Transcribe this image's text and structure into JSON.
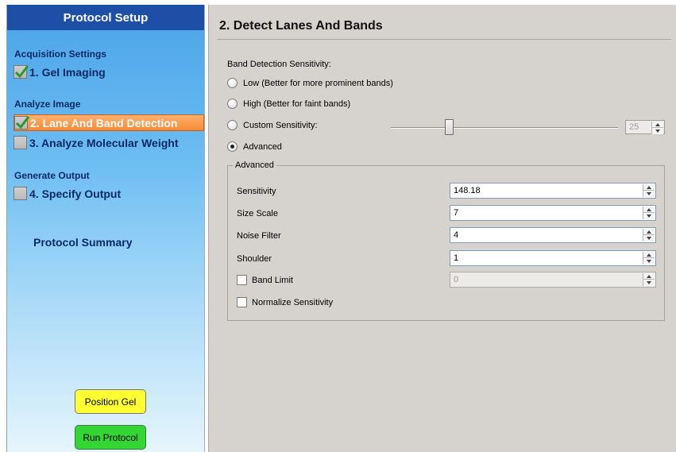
{
  "sidebar": {
    "header": "Protocol Setup",
    "sections": [
      {
        "title": "Acquisition Settings"
      },
      {
        "title": "Analyze Image"
      },
      {
        "title": "Generate Output"
      }
    ],
    "steps": [
      {
        "label": "1. Gel Imaging",
        "checked": true,
        "selected": false
      },
      {
        "label": "2. Lane And Band Detection",
        "checked": true,
        "selected": true
      },
      {
        "label": "3. Analyze Molecular Weight",
        "checked": false,
        "selected": false
      },
      {
        "label": "4. Specify Output",
        "checked": false,
        "selected": false
      }
    ],
    "summary_label": "Protocol Summary",
    "position_gel_label": "Position Gel",
    "run_protocol_label": "Run Protocol"
  },
  "main": {
    "title": "2. Detect Lanes And Bands",
    "sensitivity_label": "Band Detection Sensitivity:",
    "options": [
      {
        "label": "Low (Better for more prominent bands)",
        "selected": false
      },
      {
        "label": "High (Better for faint bands)",
        "selected": false
      },
      {
        "label": "Custom Sensitivity:",
        "selected": false
      },
      {
        "label": "Advanced",
        "selected": true
      }
    ],
    "custom_slider_value": "25",
    "advanced": {
      "group_title": "Advanced",
      "fields": [
        {
          "label": "Sensitivity",
          "value": "148.18"
        },
        {
          "label": "Size Scale",
          "value": "7"
        },
        {
          "label": "Noise Filter",
          "value": "4"
        },
        {
          "label": "Shoulder",
          "value": "1"
        }
      ],
      "band_limit": {
        "label": "Band Limit",
        "checked": false,
        "value": "0"
      },
      "normalize": {
        "label": "Normalize Sensitivity",
        "checked": false
      }
    }
  },
  "colors": {
    "header_bg": "#1e4fa6",
    "selected_step": "#f68a34",
    "position_button": "#ffff33",
    "run_button": "#33d633",
    "panel_bg": "#d6d3ce"
  }
}
